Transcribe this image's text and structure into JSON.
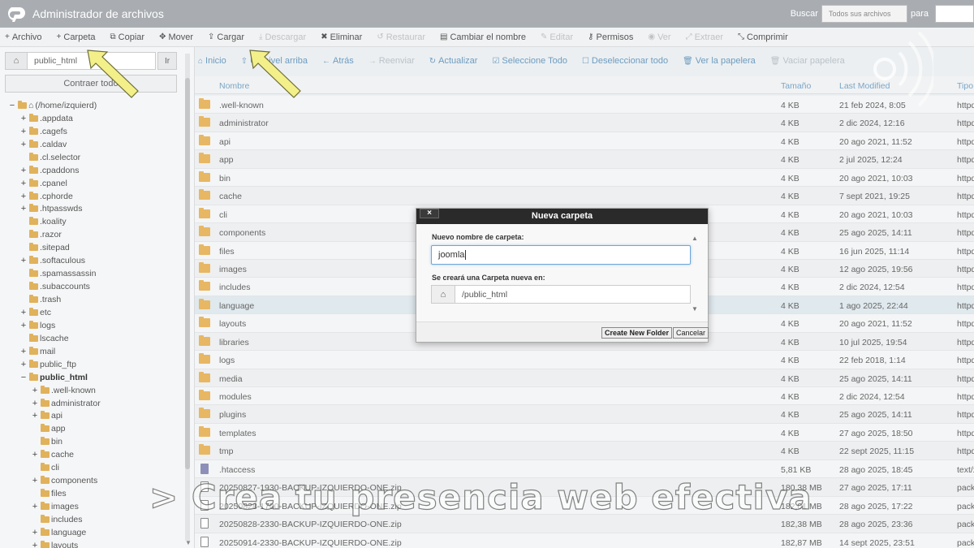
{
  "header": {
    "title": "Administrador de archivos",
    "search_label": "Buscar",
    "search_scope": "Todos sus archivos",
    "para_label": "para",
    "search_value": ""
  },
  "toolbar": [
    {
      "label": "Archivo",
      "icon": "plus-icon",
      "glyph": "+",
      "disabled": false
    },
    {
      "label": "Carpeta",
      "icon": "plus-icon",
      "glyph": "+",
      "disabled": false
    },
    {
      "label": "Copiar",
      "icon": "copy-icon",
      "glyph": "⧉",
      "disabled": false
    },
    {
      "label": "Mover",
      "icon": "move-icon",
      "glyph": "✥",
      "disabled": false
    },
    {
      "label": "Cargar",
      "icon": "upload-icon",
      "glyph": "⇪",
      "disabled": false
    },
    {
      "label": "Descargar",
      "icon": "download-icon",
      "glyph": "⤓",
      "disabled": true
    },
    {
      "label": "Eliminar",
      "icon": "delete-icon",
      "glyph": "✖",
      "disabled": false
    },
    {
      "label": "Restaurar",
      "icon": "restore-icon",
      "glyph": "↺",
      "disabled": true
    },
    {
      "label": "Cambiar el nombre",
      "icon": "rename-icon",
      "glyph": "▤",
      "disabled": false
    },
    {
      "label": "Editar",
      "icon": "edit-icon",
      "glyph": "✎",
      "disabled": true
    },
    {
      "label": "Permisos",
      "icon": "key-icon",
      "glyph": "⚷",
      "disabled": false
    },
    {
      "label": "Ver",
      "icon": "eye-icon",
      "glyph": "◉",
      "disabled": true
    },
    {
      "label": "Extraer",
      "icon": "extract-icon",
      "glyph": "⤢",
      "disabled": true
    },
    {
      "label": "Comprimir",
      "icon": "compress-icon",
      "glyph": "⤡",
      "disabled": false
    }
  ],
  "sidebar": {
    "path_value": "public_html",
    "go_label": "Ir",
    "collapse_label": "Contraer todo",
    "tree": [
      {
        "label": "(/home/izquierd)",
        "depth": 0,
        "toggle": "−",
        "home": true
      },
      {
        "label": ".appdata",
        "depth": 1,
        "toggle": "+"
      },
      {
        "label": ".cagefs",
        "depth": 1,
        "toggle": "+"
      },
      {
        "label": ".caldav",
        "depth": 1,
        "toggle": "+"
      },
      {
        "label": ".cl.selector",
        "depth": 1,
        "toggle": ""
      },
      {
        "label": ".cpaddons",
        "depth": 1,
        "toggle": "+"
      },
      {
        "label": ".cpanel",
        "depth": 1,
        "toggle": "+"
      },
      {
        "label": ".cphorde",
        "depth": 1,
        "toggle": "+"
      },
      {
        "label": ".htpasswds",
        "depth": 1,
        "toggle": "+"
      },
      {
        "label": ".koality",
        "depth": 1,
        "toggle": ""
      },
      {
        "label": ".razor",
        "depth": 1,
        "toggle": ""
      },
      {
        "label": ".sitepad",
        "depth": 1,
        "toggle": ""
      },
      {
        "label": ".softaculous",
        "depth": 1,
        "toggle": "+"
      },
      {
        "label": ".spamassassin",
        "depth": 1,
        "toggle": ""
      },
      {
        "label": ".subaccounts",
        "depth": 1,
        "toggle": ""
      },
      {
        "label": ".trash",
        "depth": 1,
        "toggle": ""
      },
      {
        "label": "etc",
        "depth": 1,
        "toggle": "+"
      },
      {
        "label": "logs",
        "depth": 1,
        "toggle": "+"
      },
      {
        "label": "lscache",
        "depth": 1,
        "toggle": ""
      },
      {
        "label": "mail",
        "depth": 1,
        "toggle": "+"
      },
      {
        "label": "public_ftp",
        "depth": 1,
        "toggle": "+"
      },
      {
        "label": "public_html",
        "depth": 1,
        "toggle": "−",
        "bold": true
      },
      {
        "label": ".well-known",
        "depth": 2,
        "toggle": "+"
      },
      {
        "label": "administrator",
        "depth": 2,
        "toggle": "+"
      },
      {
        "label": "api",
        "depth": 2,
        "toggle": "+"
      },
      {
        "label": "app",
        "depth": 2,
        "toggle": ""
      },
      {
        "label": "bin",
        "depth": 2,
        "toggle": ""
      },
      {
        "label": "cache",
        "depth": 2,
        "toggle": "+"
      },
      {
        "label": "cli",
        "depth": 2,
        "toggle": ""
      },
      {
        "label": "components",
        "depth": 2,
        "toggle": "+"
      },
      {
        "label": "files",
        "depth": 2,
        "toggle": ""
      },
      {
        "label": "images",
        "depth": 2,
        "toggle": "+"
      },
      {
        "label": "includes",
        "depth": 2,
        "toggle": ""
      },
      {
        "label": "language",
        "depth": 2,
        "toggle": "+"
      },
      {
        "label": "layouts",
        "depth": 2,
        "toggle": "+"
      }
    ]
  },
  "nav": [
    {
      "label": "Inicio",
      "icon": "home-icon",
      "glyph": "⌂",
      "disabled": false
    },
    {
      "label": "Un nivel arriba",
      "icon": "level-up-icon",
      "glyph": "⇧",
      "disabled": false
    },
    {
      "label": "Atrás",
      "icon": "back-icon",
      "glyph": "←",
      "disabled": false
    },
    {
      "label": "Reenviar",
      "icon": "forward-icon",
      "glyph": "→",
      "disabled": true
    },
    {
      "label": "Actualizar",
      "icon": "refresh-icon",
      "glyph": "↻",
      "disabled": false
    },
    {
      "label": "Seleccione Todo",
      "icon": "check-all-icon",
      "glyph": "☑",
      "disabled": false
    },
    {
      "label": "Deseleccionar todo",
      "icon": "uncheck-icon",
      "glyph": "☐",
      "disabled": false
    },
    {
      "label": "Ver la papelera",
      "icon": "trash-icon",
      "glyph": "🗑",
      "disabled": false
    },
    {
      "label": "Vaciar papelera",
      "icon": "trash-icon",
      "glyph": "🗑",
      "disabled": true
    }
  ],
  "table": {
    "headers": {
      "name": "Nombre",
      "size": "Tamaño",
      "modified": "Last Modified",
      "type": "Tipo"
    },
    "rows": [
      {
        "name": ".well-known",
        "size": "4 KB",
        "date": "21 feb 2024, 8:05",
        "type": "httpd/",
        "kind": "folder"
      },
      {
        "name": "administrator",
        "size": "4 KB",
        "date": "2 dic 2024, 12:16",
        "type": "httpd/",
        "kind": "folder"
      },
      {
        "name": "api",
        "size": "4 KB",
        "date": "20 ago 2021, 11:52",
        "type": "httpd/",
        "kind": "folder"
      },
      {
        "name": "app",
        "size": "4 KB",
        "date": "2 jul 2025, 12:24",
        "type": "httpd/",
        "kind": "folder"
      },
      {
        "name": "bin",
        "size": "4 KB",
        "date": "20 ago 2021, 10:03",
        "type": "httpd/",
        "kind": "folder"
      },
      {
        "name": "cache",
        "size": "4 KB",
        "date": "7 sept 2021, 19:25",
        "type": "httpd/",
        "kind": "folder"
      },
      {
        "name": "cli",
        "size": "4 KB",
        "date": "20 ago 2021, 10:03",
        "type": "httpd/",
        "kind": "folder"
      },
      {
        "name": "components",
        "size": "4 KB",
        "date": "25 ago 2025, 14:11",
        "type": "httpd/",
        "kind": "folder"
      },
      {
        "name": "files",
        "size": "4 KB",
        "date": "16 jun 2025, 11:14",
        "type": "httpd/",
        "kind": "folder"
      },
      {
        "name": "images",
        "size": "4 KB",
        "date": "12 ago 2025, 19:56",
        "type": "httpd/",
        "kind": "folder"
      },
      {
        "name": "includes",
        "size": "4 KB",
        "date": "2 dic 2024, 12:54",
        "type": "httpd/",
        "kind": "folder"
      },
      {
        "name": "language",
        "size": "4 KB",
        "date": "1 ago 2025, 22:44",
        "type": "httpd/",
        "kind": "folder",
        "highlight": true
      },
      {
        "name": "layouts",
        "size": "4 KB",
        "date": "20 ago 2021, 11:52",
        "type": "httpd/",
        "kind": "folder"
      },
      {
        "name": "libraries",
        "size": "4 KB",
        "date": "10 jul 2025, 19:54",
        "type": "httpd/",
        "kind": "folder"
      },
      {
        "name": "logs",
        "size": "4 KB",
        "date": "22 feb 2018, 1:14",
        "type": "httpd/",
        "kind": "folder"
      },
      {
        "name": "media",
        "size": "4 KB",
        "date": "25 ago 2025, 14:11",
        "type": "httpd/",
        "kind": "folder"
      },
      {
        "name": "modules",
        "size": "4 KB",
        "date": "2 dic 2024, 12:54",
        "type": "httpd/",
        "kind": "folder"
      },
      {
        "name": "plugins",
        "size": "4 KB",
        "date": "25 ago 2025, 14:11",
        "type": "httpd/",
        "kind": "folder"
      },
      {
        "name": "templates",
        "size": "4 KB",
        "date": "27 ago 2025, 18:50",
        "type": "httpd/",
        "kind": "folder"
      },
      {
        "name": "tmp",
        "size": "4 KB",
        "date": "22 sept 2025, 11:15",
        "type": "httpd/",
        "kind": "folder"
      },
      {
        "name": ".htaccess",
        "size": "5,81 KB",
        "date": "28 ago 2025, 18:45",
        "type": "text/x",
        "kind": "doc"
      },
      {
        "name": "20250827-1930-BACKUP-IZQUIERDO-ONE.zip",
        "size": "180,38 MB",
        "date": "27 ago 2025, 17:11",
        "type": "packa",
        "kind": "zip"
      },
      {
        "name": "20250828-1700-BACKUP-IZQUIERDO-ONE.zip",
        "size": "182,01 MB",
        "date": "28 ago 2025, 17:22",
        "type": "packa",
        "kind": "zip"
      },
      {
        "name": "20250828-2330-BACKUP-IZQUIERDO-ONE.zip",
        "size": "182,38 MB",
        "date": "28 ago 2025, 23:36",
        "type": "packa",
        "kind": "zip"
      },
      {
        "name": "20250914-2330-BACKUP-IZQUIERDO-ONE.zip",
        "size": "182,87 MB",
        "date": "14 sept 2025, 23:51",
        "type": "packa",
        "kind": "zip"
      }
    ]
  },
  "dialog": {
    "title": "Nueva carpeta",
    "close_label": "×",
    "name_label": "Nuevo nombre de carpeta:",
    "name_value": "joomla",
    "location_label": "Se creará una Carpeta nueva en:",
    "location_value": "/public_html",
    "create_label": "Create New Folder",
    "cancel_label": "Cancelar"
  },
  "caption": "> Crea tu presencia web efectiva",
  "colors": {
    "folder": "#e7b764",
    "header_bg": "#a9adb2",
    "link": "#6d9cc0",
    "arrow": "#f3f08a"
  }
}
